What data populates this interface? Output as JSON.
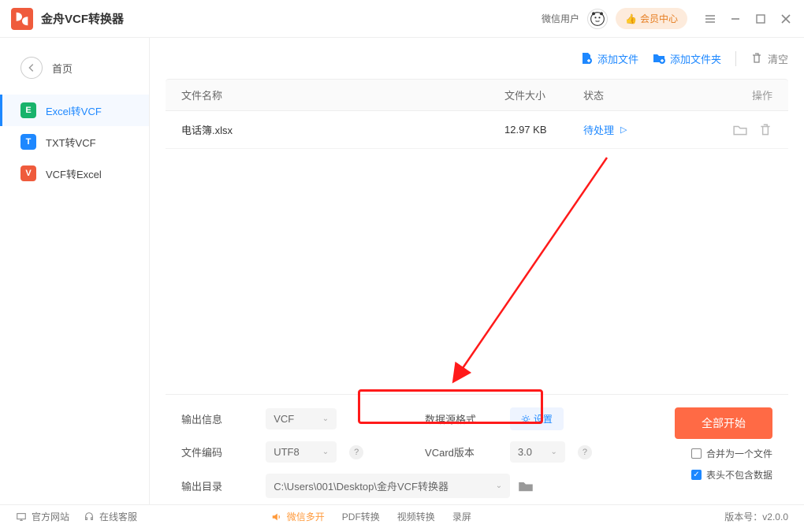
{
  "app": {
    "title": "金舟VCF转换器"
  },
  "header": {
    "user_label": "微信用户",
    "member_label": "会员中心"
  },
  "sidebar": {
    "home": "首页",
    "items": [
      {
        "badge": "E",
        "label": "Excel转VCF"
      },
      {
        "badge": "T",
        "label": "TXT转VCF"
      },
      {
        "badge": "V",
        "label": "VCF转Excel"
      }
    ]
  },
  "toolbar": {
    "add_file": "添加文件",
    "add_folder": "添加文件夹",
    "clear": "清空"
  },
  "table": {
    "headers": {
      "name": "文件名称",
      "size": "文件大小",
      "status": "状态",
      "action": "操作"
    },
    "rows": [
      {
        "name": "电话簿.xlsx",
        "size": "12.97 KB",
        "status": "待处理"
      }
    ]
  },
  "settings": {
    "output_info_label": "输出信息",
    "output_format": "VCF",
    "data_source_label": "数据源格式",
    "set_btn": "设置",
    "encoding_label": "文件编码",
    "encoding": "UTF8",
    "vcard_label": "VCard版本",
    "vcard": "3.0",
    "output_dir_label": "输出目录",
    "output_dir": "C:\\Users\\001\\Desktop\\金舟VCF转换器",
    "start_all": "全部开始",
    "merge_label": "合并为一个文件",
    "header_skip_label": "表头不包含数据"
  },
  "footer": {
    "site": "官方网站",
    "service": "在线客服",
    "wechat": "微信多开",
    "pdf": "PDF转换",
    "video": "视频转换",
    "record": "录屏",
    "version": "版本号：v2.0.0"
  }
}
